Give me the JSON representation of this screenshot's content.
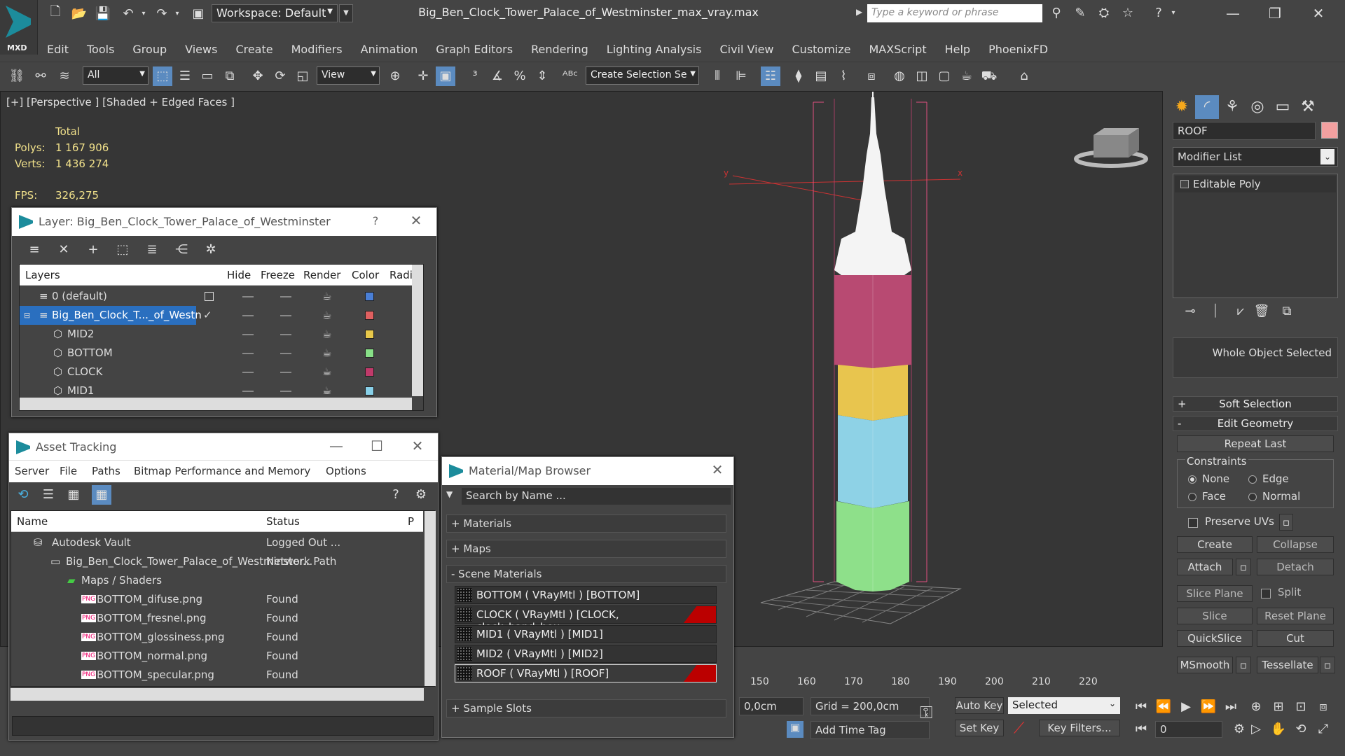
{
  "app": {
    "logo_text": "MXD",
    "workspace": "Workspace: Default",
    "file_title": "Big_Ben_Clock_Tower_Palace_of_Westminster_max_vray.max",
    "search_placeholder": "Type a keyword or phrase"
  },
  "menu": [
    "Edit",
    "Tools",
    "Group",
    "Views",
    "Create",
    "Modifiers",
    "Animation",
    "Graph Editors",
    "Rendering",
    "Lighting Analysis",
    "Civil View",
    "Customize",
    "MAXScript",
    "Help",
    "PhoenixFD"
  ],
  "toolbar": {
    "filter": "All",
    "refcoord": "View",
    "selection_set": "Create Selection Se"
  },
  "viewport": {
    "label": "[+] [Perspective ] [Shaded + Edged Faces ]",
    "stats_total": "Total",
    "polys_label": "Polys:",
    "polys": "1 167 906",
    "verts_label": "Verts:",
    "verts": "1 436 274",
    "fps_label": "FPS:",
    "fps": "326,275"
  },
  "layer_win": {
    "title": "Layer: Big_Ben_Clock_Tower_Palace_of_Westminster",
    "help": "?",
    "cols": [
      "Layers",
      "Hide",
      "Freeze",
      "Render",
      "Color",
      "Radi"
    ],
    "rows": [
      {
        "name": "0 (default)",
        "color": "#4a7fd6"
      },
      {
        "name": "Big_Ben_Clock_T..._of_Westn",
        "color": "#e06060"
      },
      {
        "name": "MID2",
        "color": "#e8c84a"
      },
      {
        "name": "BOTTOM",
        "color": "#88e088"
      },
      {
        "name": "CLOCK",
        "color": "#c03a6a"
      },
      {
        "name": "MID1",
        "color": "#88d0e8"
      }
    ]
  },
  "asset_win": {
    "title": "Asset Tracking",
    "menu": [
      "Server",
      "File",
      "Paths",
      "Bitmap Performance and Memory",
      "Options"
    ],
    "cols": [
      "Name",
      "Status",
      "P"
    ],
    "rows": [
      {
        "name": "Autodesk Vault",
        "status": "Logged Out ..."
      },
      {
        "name": "Big_Ben_Clock_Tower_Palace_of_Westminster...",
        "status": "Network Path"
      },
      {
        "name": "Maps / Shaders",
        "status": ""
      },
      {
        "name": "BOTTOM_difuse.png",
        "status": "Found"
      },
      {
        "name": "BOTTOM_fresnel.png",
        "status": "Found"
      },
      {
        "name": "BOTTOM_glossiness.png",
        "status": "Found"
      },
      {
        "name": "BOTTOM_normal.png",
        "status": "Found"
      },
      {
        "name": "BOTTOM_specular.png",
        "status": "Found"
      }
    ],
    "png_badge": "PNG"
  },
  "mat_win": {
    "title": "Material/Map Browser",
    "search_placeholder": "Search by Name ...",
    "materials": "+ Materials",
    "maps": "+ Maps",
    "scene": "- Scene Materials",
    "items": [
      "BOTTOM  ( VRayMtl )  [BOTTOM]",
      "CLOCK  ( VRayMtl )  [CLOCK, clock_hand_hou...",
      "MID1  ( VRayMtl )  [MID1]",
      "MID2  ( VRayMtl )  [MID2]",
      "ROOF  ( VRayMtl )  [ROOF]"
    ],
    "samples": "+ Sample Slots"
  },
  "panel": {
    "object_name": "ROOF",
    "object_color": "#f2a0a0",
    "modifier_list": "Modifier List",
    "stack_item": "Editable Poly",
    "selection_info": "Whole Object Selected",
    "soft_selection": "Soft Selection",
    "edit_geometry": "Edit Geometry",
    "repeat_last": "Repeat Last",
    "constraints": "Constraints",
    "c_none": "None",
    "c_edge": "Edge",
    "c_face": "Face",
    "c_normal": "Normal",
    "preserve_uvs": "Preserve UVs",
    "create": "Create",
    "collapse": "Collapse",
    "attach": "Attach",
    "detach": "Detach",
    "slice_plane": "Slice Plane",
    "split": "Split",
    "slice": "Slice",
    "reset_plane": "Reset Plane",
    "quickslice": "QuickSlice",
    "cut": "Cut",
    "msmooth": "MSmooth",
    "tessellate": "Tessellate"
  },
  "timeline": {
    "ticks": [
      "150",
      "160",
      "170",
      "180",
      "190",
      "200",
      "210",
      "220"
    ]
  },
  "status": {
    "coord": "0,0cm",
    "grid": "Grid = 200,0cm",
    "add_time_tag": "Add Time Tag",
    "auto_key": "Auto Key",
    "selected": "Selected",
    "set_key": "Set Key",
    "key_filters": "Key Filters...",
    "frame": "0"
  },
  "pm": {
    "plus": "+",
    "minus": "-"
  }
}
